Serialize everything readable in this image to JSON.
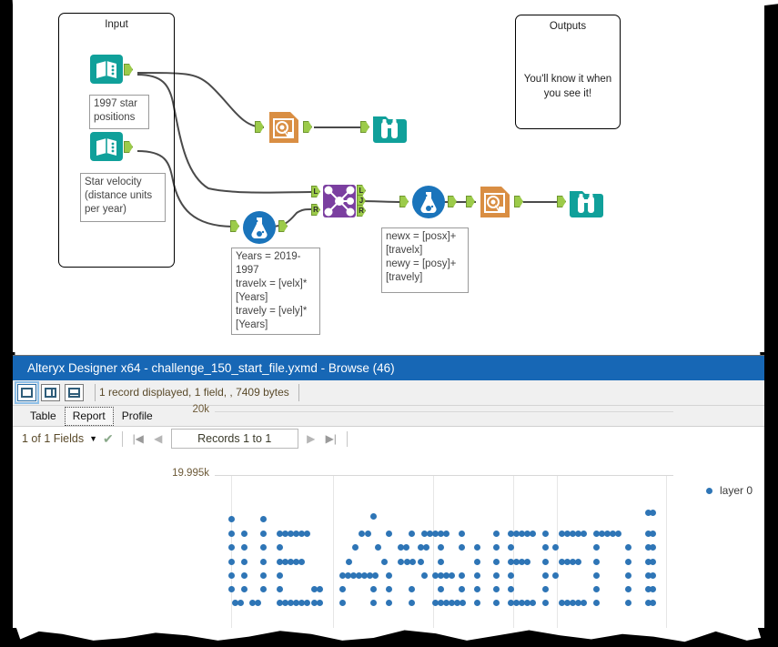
{
  "canvas": {
    "containers": [
      {
        "name": "input",
        "title": "Input"
      },
      {
        "name": "outputs",
        "title": "Outputs",
        "body": "You'll know it when you see it!"
      }
    ],
    "annotations": [
      {
        "name": "input-1-annotation",
        "text": "1997 star positions"
      },
      {
        "name": "input-2-annotation",
        "text": "Star velocity (distance units per year)"
      },
      {
        "name": "formula-1-annotation",
        "text": "Years = 2019-1997\ntravelx = [velx]*[Years]\ntravely = [vely]*[Years]"
      },
      {
        "name": "formula-2-annotation",
        "text": "newx = [posx]+[travelx]\nnewy = [posy]+[travely]"
      }
    ],
    "nodes": [
      {
        "name": "input-data-tool-1",
        "icon": "input-data-icon",
        "type": "input"
      },
      {
        "name": "input-data-tool-2",
        "icon": "input-data-icon",
        "type": "input"
      },
      {
        "name": "render-tool-1",
        "icon": "render-icon",
        "type": "render"
      },
      {
        "name": "browse-tool-1",
        "icon": "browse-binoculars-icon",
        "type": "browse"
      },
      {
        "name": "join-tool",
        "icon": "join-icon",
        "type": "join",
        "ports": [
          "L",
          "J",
          "R"
        ]
      },
      {
        "name": "formula-tool-1",
        "icon": "formula-flask-icon",
        "type": "formula"
      },
      {
        "name": "formula-tool-2",
        "icon": "formula-flask-icon",
        "type": "formula"
      },
      {
        "name": "render-tool-2",
        "icon": "render-icon",
        "type": "render"
      },
      {
        "name": "browse-tool-2",
        "icon": "browse-binoculars-icon",
        "type": "browse"
      }
    ]
  },
  "window": {
    "title": "Alteryx Designer x64 - challenge_150_start_file.yxmd - Browse (46)",
    "record_info": "1 record displayed, 1 field, , 7409 bytes",
    "layout_buttons": [
      "single-pane-layout",
      "vertical-split-layout",
      "horizontal-split-layout"
    ],
    "selected_layout": 0,
    "tabs": [
      {
        "label": "Table",
        "active": false
      },
      {
        "label": "Report",
        "active": true
      },
      {
        "label": "Profile",
        "active": false
      }
    ],
    "nav": {
      "fields_label": "1 of 1 Fields",
      "records_label": "Records 1 to 1",
      "first_icon": "first-record-icon",
      "prev_icon": "previous-record-icon",
      "next_icon": "next-record-icon",
      "last_icon": "last-record-icon",
      "dropdown_icon": "chevron-down-icon",
      "check_icon": "check-icon"
    }
  },
  "chart_data": {
    "type": "scatter",
    "title": "",
    "xlabel": "",
    "ylabel": "",
    "legend": [
      {
        "label": "layer 0",
        "color": "#2e75b6"
      }
    ],
    "legend_position": "right",
    "grid": true,
    "yticks": [
      {
        "label": "20k",
        "value": 20000
      },
      {
        "label": "19.995k",
        "value": 19995
      }
    ],
    "ylim": [
      19992.5,
      20001
    ],
    "xlim": [
      0,
      100
    ],
    "xgrid_positions": [
      5.5,
      33.5,
      61.5,
      83.5,
      95.5
    ],
    "message": "WE AMPLIFIED!",
    "point_color": "#2e75b6",
    "glyph_rows": 7,
    "glyphs": [
      {
        "char": "W",
        "cols": [
          "1000001",
          "1000001",
          "1000001",
          "1001001",
          "1011101",
          "1110111",
          "1100011"
        ]
      },
      {
        "char": "E",
        "cols": [
          "0111111",
          "0100000",
          "0100000",
          "0111110",
          "0100000",
          "0100000",
          "0111111"
        ]
      },
      {
        "char": ".",
        "cols": [
          "0000000",
          "0000000",
          "0000000",
          "0000000",
          "0000000",
          "0000011",
          "0000011"
        ]
      },
      {
        "char": "A",
        "cols": [
          "0001000",
          "0010100",
          "0100010",
          "0100010",
          "0111110",
          "0100010",
          "0100010"
        ]
      },
      {
        "char": "M",
        "cols": [
          "1000001",
          "1100011",
          "1010101",
          "1001001",
          "1000001",
          "1000001",
          "1000001"
        ]
      },
      {
        "char": "P",
        "cols": [
          "0111110",
          "0100001",
          "0100001",
          "0111110",
          "0100000",
          "0100000",
          "0100000"
        ]
      },
      {
        "char": "L",
        "cols": [
          "0100000",
          "0100000",
          "0100000",
          "0100000",
          "0100000",
          "0100000",
          "0111111"
        ]
      },
      {
        "char": "I",
        "cols": [
          "0001000",
          "0001000",
          "0001000",
          "0001000",
          "0001000",
          "0001000",
          "0001000"
        ]
      },
      {
        "char": "F",
        "cols": [
          "0111111",
          "0100000",
          "0111100",
          "0100000",
          "0100000",
          "0100000",
          "0100000"
        ]
      },
      {
        "char": "I",
        "cols": [
          "0001000",
          "0001000",
          "0001000",
          "0001000",
          "0001000",
          "0001000",
          "0001000"
        ]
      },
      {
        "char": "E",
        "cols": [
          "0111111",
          "0100000",
          "0111110",
          "0100000",
          "0100000",
          "0100000",
          "0111111"
        ]
      },
      {
        "char": "D",
        "cols": [
          "0111110",
          "0100001",
          "0100001",
          "0100001",
          "0100001",
          "0100001",
          "0111110"
        ]
      },
      {
        "char": "!",
        "cols": [
          "0001100",
          "0001100",
          "0001100",
          "0001100",
          "0001100",
          "0000000",
          "0001100"
        ]
      }
    ],
    "points": [
      [
        254,
        570
      ],
      [
        289,
        570
      ],
      [
        410,
        567
      ],
      [
        712,
        563
      ],
      [
        717,
        563
      ],
      [
        254,
        586
      ],
      [
        268,
        586
      ],
      [
        289,
        586
      ],
      [
        307,
        586
      ],
      [
        313,
        586
      ],
      [
        319,
        586
      ],
      [
        325,
        586
      ],
      [
        331,
        586
      ],
      [
        337,
        586
      ],
      [
        397,
        586
      ],
      [
        404,
        586
      ],
      [
        427,
        586
      ],
      [
        452,
        586
      ],
      [
        466,
        586
      ],
      [
        472,
        586
      ],
      [
        478,
        586
      ],
      [
        484,
        586
      ],
      [
        490,
        586
      ],
      [
        507,
        586
      ],
      [
        545,
        586
      ],
      [
        561,
        586
      ],
      [
        567,
        586
      ],
      [
        573,
        586
      ],
      [
        579,
        586
      ],
      [
        585,
        586
      ],
      [
        599,
        586
      ],
      [
        617,
        586
      ],
      [
        623,
        586
      ],
      [
        629,
        586
      ],
      [
        635,
        586
      ],
      [
        641,
        586
      ],
      [
        655,
        586
      ],
      [
        661,
        586
      ],
      [
        667,
        586
      ],
      [
        673,
        586
      ],
      [
        679,
        586
      ],
      [
        712,
        586
      ],
      [
        717,
        586
      ],
      [
        254,
        601
      ],
      [
        268,
        601
      ],
      [
        289,
        601
      ],
      [
        307,
        601
      ],
      [
        390,
        601
      ],
      [
        415,
        601
      ],
      [
        440,
        601
      ],
      [
        446,
        601
      ],
      [
        462,
        601
      ],
      [
        468,
        601
      ],
      [
        484,
        601
      ],
      [
        507,
        601
      ],
      [
        524,
        601
      ],
      [
        545,
        601
      ],
      [
        561,
        601
      ],
      [
        599,
        601
      ],
      [
        610,
        601
      ],
      [
        655,
        601
      ],
      [
        690,
        601
      ],
      [
        712,
        601
      ],
      [
        717,
        601
      ],
      [
        254,
        617
      ],
      [
        268,
        617
      ],
      [
        289,
        617
      ],
      [
        307,
        617
      ],
      [
        313,
        617
      ],
      [
        319,
        617
      ],
      [
        325,
        617
      ],
      [
        331,
        617
      ],
      [
        383,
        617
      ],
      [
        422,
        617
      ],
      [
        440,
        617
      ],
      [
        447,
        617
      ],
      [
        453,
        617
      ],
      [
        462,
        617
      ],
      [
        484,
        617
      ],
      [
        524,
        617
      ],
      [
        545,
        617
      ],
      [
        561,
        617
      ],
      [
        567,
        617
      ],
      [
        573,
        617
      ],
      [
        579,
        617
      ],
      [
        599,
        617
      ],
      [
        617,
        617
      ],
      [
        623,
        617
      ],
      [
        629,
        617
      ],
      [
        635,
        617
      ],
      [
        655,
        617
      ],
      [
        690,
        617
      ],
      [
        712,
        617
      ],
      [
        717,
        617
      ],
      [
        254,
        632
      ],
      [
        268,
        632
      ],
      [
        289,
        632
      ],
      [
        307,
        632
      ],
      [
        376,
        632
      ],
      [
        382,
        632
      ],
      [
        388,
        632
      ],
      [
        394,
        632
      ],
      [
        400,
        632
      ],
      [
        406,
        632
      ],
      [
        412,
        632
      ],
      [
        427,
        632
      ],
      [
        466,
        632
      ],
      [
        478,
        632
      ],
      [
        484,
        632
      ],
      [
        490,
        632
      ],
      [
        496,
        632
      ],
      [
        507,
        632
      ],
      [
        524,
        632
      ],
      [
        545,
        632
      ],
      [
        561,
        632
      ],
      [
        599,
        632
      ],
      [
        610,
        632
      ],
      [
        655,
        632
      ],
      [
        690,
        632
      ],
      [
        712,
        632
      ],
      [
        717,
        632
      ],
      [
        254,
        647
      ],
      [
        268,
        647
      ],
      [
        289,
        647
      ],
      [
        307,
        647
      ],
      [
        345,
        647
      ],
      [
        351,
        647
      ],
      [
        376,
        647
      ],
      [
        410,
        647
      ],
      [
        427,
        647
      ],
      [
        452,
        647
      ],
      [
        484,
        647
      ],
      [
        507,
        647
      ],
      [
        524,
        647
      ],
      [
        545,
        647
      ],
      [
        561,
        647
      ],
      [
        599,
        647
      ],
      [
        655,
        647
      ],
      [
        690,
        647
      ],
      [
        712,
        647
      ],
      [
        717,
        647
      ],
      [
        258,
        662
      ],
      [
        264,
        662
      ],
      [
        277,
        662
      ],
      [
        283,
        662
      ],
      [
        307,
        662
      ],
      [
        313,
        662
      ],
      [
        319,
        662
      ],
      [
        325,
        662
      ],
      [
        331,
        662
      ],
      [
        337,
        662
      ],
      [
        345,
        662
      ],
      [
        351,
        662
      ],
      [
        376,
        662
      ],
      [
        410,
        662
      ],
      [
        427,
        662
      ],
      [
        452,
        662
      ],
      [
        478,
        662
      ],
      [
        484,
        662
      ],
      [
        490,
        662
      ],
      [
        496,
        662
      ],
      [
        502,
        662
      ],
      [
        508,
        662
      ],
      [
        524,
        662
      ],
      [
        545,
        662
      ],
      [
        561,
        662
      ],
      [
        567,
        662
      ],
      [
        573,
        662
      ],
      [
        579,
        662
      ],
      [
        585,
        662
      ],
      [
        599,
        662
      ],
      [
        617,
        662
      ],
      [
        623,
        662
      ],
      [
        629,
        662
      ],
      [
        635,
        662
      ],
      [
        641,
        662
      ],
      [
        655,
        662
      ],
      [
        690,
        662
      ],
      [
        712,
        662
      ],
      [
        717,
        662
      ]
    ]
  }
}
